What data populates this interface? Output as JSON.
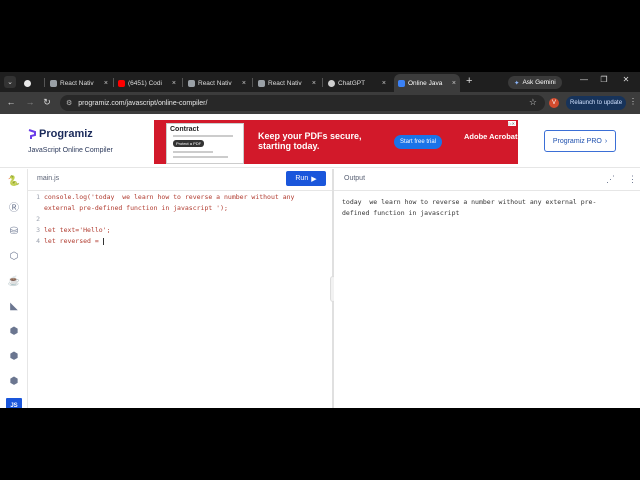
{
  "browser": {
    "tabs": [
      {
        "label": "",
        "icon": "github-icon"
      },
      {
        "label": "React Nativ",
        "icon": "page-icon"
      },
      {
        "label": "(6451) Codi",
        "icon": "youtube-icon"
      },
      {
        "label": "React Nativ",
        "icon": "page-icon"
      },
      {
        "label": "React Nativ",
        "icon": "page-icon"
      },
      {
        "label": "ChatGPT",
        "icon": "chatgpt-icon"
      },
      {
        "label": "Online Java",
        "icon": "programiz-icon",
        "active": true
      }
    ],
    "close_glyph": "×",
    "new_tab": "+",
    "gemini_label": "Ask Gemini",
    "url": "programiz.com/javascript/online-compiler/",
    "profile_initial": "V",
    "relaunch_label": "Relaunch to update"
  },
  "site": {
    "logo": "Programiz",
    "subtitle": "JavaScript Online Compiler",
    "pro_button": "Programiz PRO",
    "ad": {
      "doc_title": "Contract",
      "protect_label": "Protect a PDF",
      "headline": "Keep your PDFs secure, starting today.",
      "cta": "Start free trial",
      "brand": "Adobe Acrobat"
    }
  },
  "editor": {
    "file_name": "main.js",
    "run_label": "Run",
    "lines": [
      {
        "num": "1",
        "text": "console.log('today  we learn how to reverse a number without any",
        "cont": "external pre-defined function in javascript ');"
      },
      {
        "num": "2",
        "text": ""
      },
      {
        "num": "3",
        "text": "let text='Hello';"
      },
      {
        "num": "4",
        "text": "let reversed = "
      }
    ]
  },
  "output": {
    "title": "Output",
    "text": "today  we learn how to reverse a number without any external pre-\ndefined function in javascript"
  },
  "sidebar": {
    "items": [
      "python-icon",
      "r-icon",
      "sql-icon",
      "html-icon",
      "java-icon",
      "kotlin-icon",
      "c-icon",
      "cpp-icon",
      "csharp-icon",
      "js-icon"
    ],
    "js_label": "JS"
  },
  "colors": {
    "accent": "#1a56db",
    "ad_red": "#d2192a",
    "code": "#b03a2e"
  }
}
